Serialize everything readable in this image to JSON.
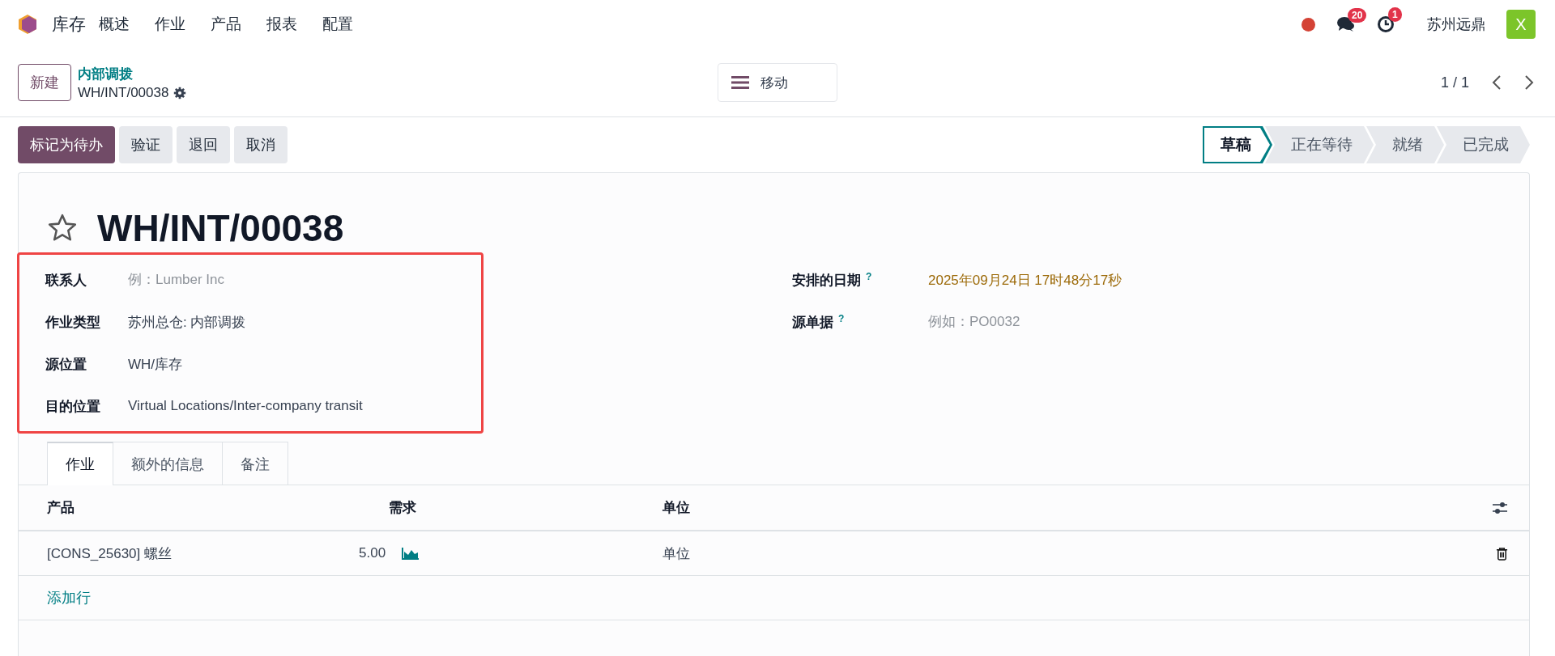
{
  "navbar": {
    "app": "库存",
    "menu": [
      "概述",
      "作业",
      "产品",
      "报表",
      "配置"
    ],
    "messages_count": "20",
    "activities_count": "1",
    "company": "苏州远鼎",
    "avatar": "X"
  },
  "control_panel": {
    "new_button": "新建",
    "breadcrumb": "内部调拨",
    "record": "WH/INT/00038",
    "action_menu": "移动",
    "pager": "1 / 1"
  },
  "actions": [
    {
      "label": "标记为待办",
      "primary": true
    },
    {
      "label": "验证",
      "primary": false
    },
    {
      "label": "退回",
      "primary": false
    },
    {
      "label": "取消",
      "primary": false
    }
  ],
  "status_bar": [
    {
      "label": "草稿",
      "selected": true
    },
    {
      "label": "正在等待",
      "selected": false
    },
    {
      "label": "就绪",
      "selected": false
    },
    {
      "label": "已完成",
      "selected": false
    }
  ],
  "form": {
    "title": "WH/INT/00038",
    "starred": false,
    "left_fields": {
      "highlighted": true,
      "fields": [
        {
          "label": "联系人",
          "placeholder": "例：Lumber Inc"
        },
        {
          "label": "作业类型",
          "value": "苏州总仓: 内部调拨"
        },
        {
          "label": "源位置",
          "value": "WH/库存"
        },
        {
          "label": "目的位置",
          "value": "Virtual Locations/Inter-company transit"
        }
      ]
    },
    "right_fields": [
      {
        "label": "安排的日期",
        "help": "?",
        "value": "2025年09月24日 17时48分17秒",
        "kind": "date"
      },
      {
        "label": "源单据",
        "help": "?",
        "placeholder": "例如：PO0032",
        "kind": "text"
      }
    ],
    "tabs": [
      {
        "label": "作业",
        "selected": true
      },
      {
        "label": "额外的信息",
        "selected": false
      },
      {
        "label": "备注",
        "selected": false
      }
    ],
    "table": {
      "columns": [
        "产品",
        "需求",
        "单位"
      ],
      "rows": [
        {
          "product": "[CONS_25630] 螺丝",
          "demand": "5.00",
          "unit": "单位"
        }
      ],
      "add_line": "添加行"
    }
  }
}
